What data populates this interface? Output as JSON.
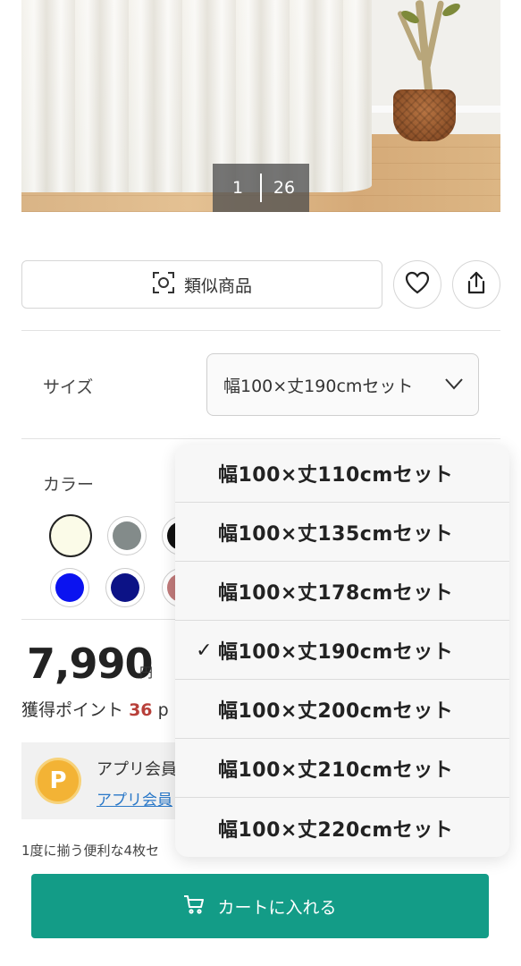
{
  "gallery": {
    "current": "1",
    "total": "26"
  },
  "actions": {
    "similar_label": "類似商品"
  },
  "size": {
    "label": "サイズ",
    "selected": "幅100×丈190cmセット",
    "options": [
      "幅100×丈110cmセット",
      "幅100×丈135cmセット",
      "幅100×丈178cmセット",
      "幅100×丈190cmセット",
      "幅100×丈200cmセット",
      "幅100×丈210cmセット",
      "幅100×丈220cmセット"
    ],
    "checked_index": 3,
    "check_mark": "✓"
  },
  "color": {
    "label": "カラー",
    "swatches": [
      "#fbfbe8",
      "#838b8a",
      "#111111",
      "#0b13f0",
      "#0c1286",
      "#c07a7a"
    ]
  },
  "price": {
    "value": "7,990",
    "unit": "円"
  },
  "points": {
    "label": "獲得ポイント",
    "value": "36",
    "suffix": "p"
  },
  "app": {
    "icon_letter": "P",
    "title": "アプリ会員",
    "link": "アプリ会員"
  },
  "description": "1度に揃う便利な4枚セ",
  "cart": {
    "label": "カートに入れる"
  },
  "colors": {
    "accent": "#139c87",
    "points": "#b8403a",
    "link": "#2a78c8",
    "badge": "#f3b335"
  }
}
